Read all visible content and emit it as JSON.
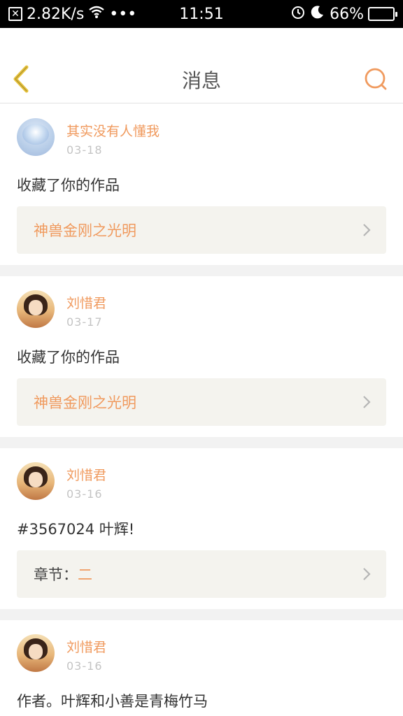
{
  "status_bar": {
    "notification_icon": "x-box-icon",
    "speed": "2.82K/s",
    "time": "11:51",
    "battery_percent": "66%",
    "battery_level": 0.66
  },
  "header": {
    "title": "消息",
    "back_icon": "chevron-left-icon",
    "search_icon": "search-icon"
  },
  "messages": [
    {
      "user": "其实没有人懂我",
      "date": "03-18",
      "content": "收藏了你的作品",
      "ref_title": "神兽金刚之光明",
      "avatar": "avatar-blue"
    },
    {
      "user": "刘惜君",
      "date": "03-17",
      "content": "收藏了你的作品",
      "ref_title": "神兽金刚之光明",
      "avatar": "avatar-girl"
    },
    {
      "user": "刘惜君",
      "date": "03-16",
      "content": "#3567024 叶辉!",
      "ref_label": "章节：",
      "ref_title": "二",
      "avatar": "avatar-girl"
    },
    {
      "user": "刘惜君",
      "date": "03-16",
      "content": "作者。叶辉和小善是青梅竹马",
      "avatar": "avatar-girl"
    }
  ],
  "colors": {
    "accent": "#f09a5e",
    "ref_bg": "#f4f3ee",
    "separator": "#f2f2f2"
  }
}
